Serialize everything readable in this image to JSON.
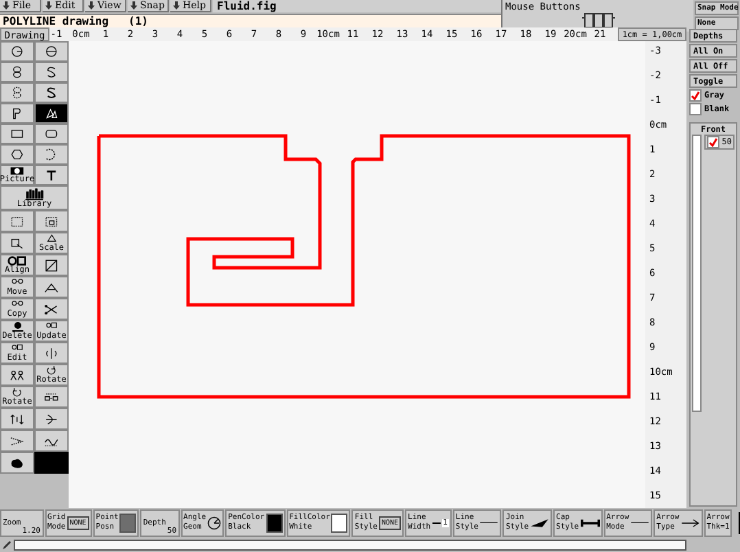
{
  "menu": [
    {
      "label": "File"
    },
    {
      "label": "Edit"
    },
    {
      "label": "View"
    },
    {
      "label": "Snap"
    },
    {
      "label": "Help"
    }
  ],
  "filename": "Fluid.fig",
  "message": "POLYLINE drawing   (1)",
  "mouse_buttons": {
    "title": "Mouse Buttons"
  },
  "snap_mode": {
    "title": "Snap Mode",
    "value": "None"
  },
  "ruler": {
    "scale": "1cm = 1,00cm",
    "top_labels": [
      "-1",
      "0cm",
      "1",
      "2",
      "3",
      "4",
      "5",
      "6",
      "7",
      "8",
      "9",
      "10cm",
      "11",
      "12",
      "13",
      "14",
      "15",
      "16",
      "17",
      "18",
      "19",
      "20cm",
      "21"
    ],
    "side_labels": [
      "-3",
      "-2",
      "-1",
      "0cm",
      "1",
      "2",
      "3",
      "4",
      "5",
      "6",
      "7",
      "8",
      "9",
      "10cm",
      "11",
      "12",
      "13",
      "14",
      "15"
    ]
  },
  "toolbar": {
    "title": "Drawing",
    "drawing_modes": [
      {
        "selected": false
      },
      {
        "selected": false
      },
      {
        "selected": false
      },
      {
        "selected": false
      },
      {
        "selected": false
      },
      {
        "selected": false
      },
      {
        "selected": false
      },
      {
        "selected": true
      },
      {
        "selected": false
      },
      {
        "selected": false
      },
      {
        "selected": false
      },
      {
        "selected": false
      },
      {
        "label": "Picture",
        "selected": false
      },
      {
        "selected": false
      }
    ],
    "library": {
      "label": "Library",
      "selected": false
    },
    "edit_modes": [
      {
        "selected": false
      },
      {
        "selected": false
      },
      {
        "selected": false
      },
      {
        "label": "Scale",
        "selected": false
      },
      {
        "label": "Align",
        "selected": false
      },
      {
        "selected": false
      },
      {
        "label": "Move",
        "selected": false
      },
      {
        "selected": false
      },
      {
        "label": "Copy",
        "selected": false
      },
      {
        "selected": false
      },
      {
        "label": "Delete",
        "selected": false
      },
      {
        "label": "Update",
        "selected": false
      },
      {
        "label": "Edit",
        "selected": false
      },
      {
        "selected": false
      },
      {
        "selected": false
      },
      {
        "label": "Rotate",
        "selected": false
      },
      {
        "label": "Rotate",
        "selected": false
      },
      {
        "selected": false
      },
      {
        "selected": false
      },
      {
        "selected": false
      },
      {
        "selected": false
      },
      {
        "selected": false
      },
      {
        "selected": false
      }
    ]
  },
  "depth_panel": {
    "buttons": [
      "Depths",
      "All On",
      "All Off",
      "Toggle"
    ],
    "options": [
      {
        "label": "Gray",
        "checked": true
      },
      {
        "label": "Blank",
        "checked": false
      }
    ],
    "front_label": "Front",
    "depths": [
      {
        "label": "50",
        "checked": true
      }
    ]
  },
  "canvas": {
    "color": "#ff0000"
  },
  "indicators": [
    {
      "kind": "value",
      "label": "Zoom",
      "value": "1.20"
    },
    {
      "kind": "badge",
      "label": "Grid\nMode",
      "value": "NONE"
    },
    {
      "kind": "swatch",
      "label": "Point\nPosn",
      "color": "#6e6e6e"
    },
    {
      "kind": "value",
      "label": "Depth",
      "value": "50"
    },
    {
      "kind": "dial",
      "label": "Angle\nGeom"
    },
    {
      "kind": "swatch",
      "label": "PenColor\nBlack",
      "color": "#000000"
    },
    {
      "kind": "swatch",
      "label": "FillColor\nWhite",
      "color": "#ffffff"
    },
    {
      "kind": "badge",
      "label": "Fill\nStyle",
      "value": "NONE"
    },
    {
      "kind": "width",
      "label": "Line\nWidth",
      "value": "1"
    },
    {
      "kind": "line",
      "label": "Line\nStyle"
    },
    {
      "kind": "join",
      "label": "Join\nStyle"
    },
    {
      "kind": "cap",
      "label": "Cap\nStyle"
    },
    {
      "kind": "line",
      "label": "Arrow\nMode"
    },
    {
      "kind": "arrow",
      "label": "Arrow\nType"
    },
    {
      "kind": "text",
      "label": "Arrow\nThk=1"
    }
  ]
}
